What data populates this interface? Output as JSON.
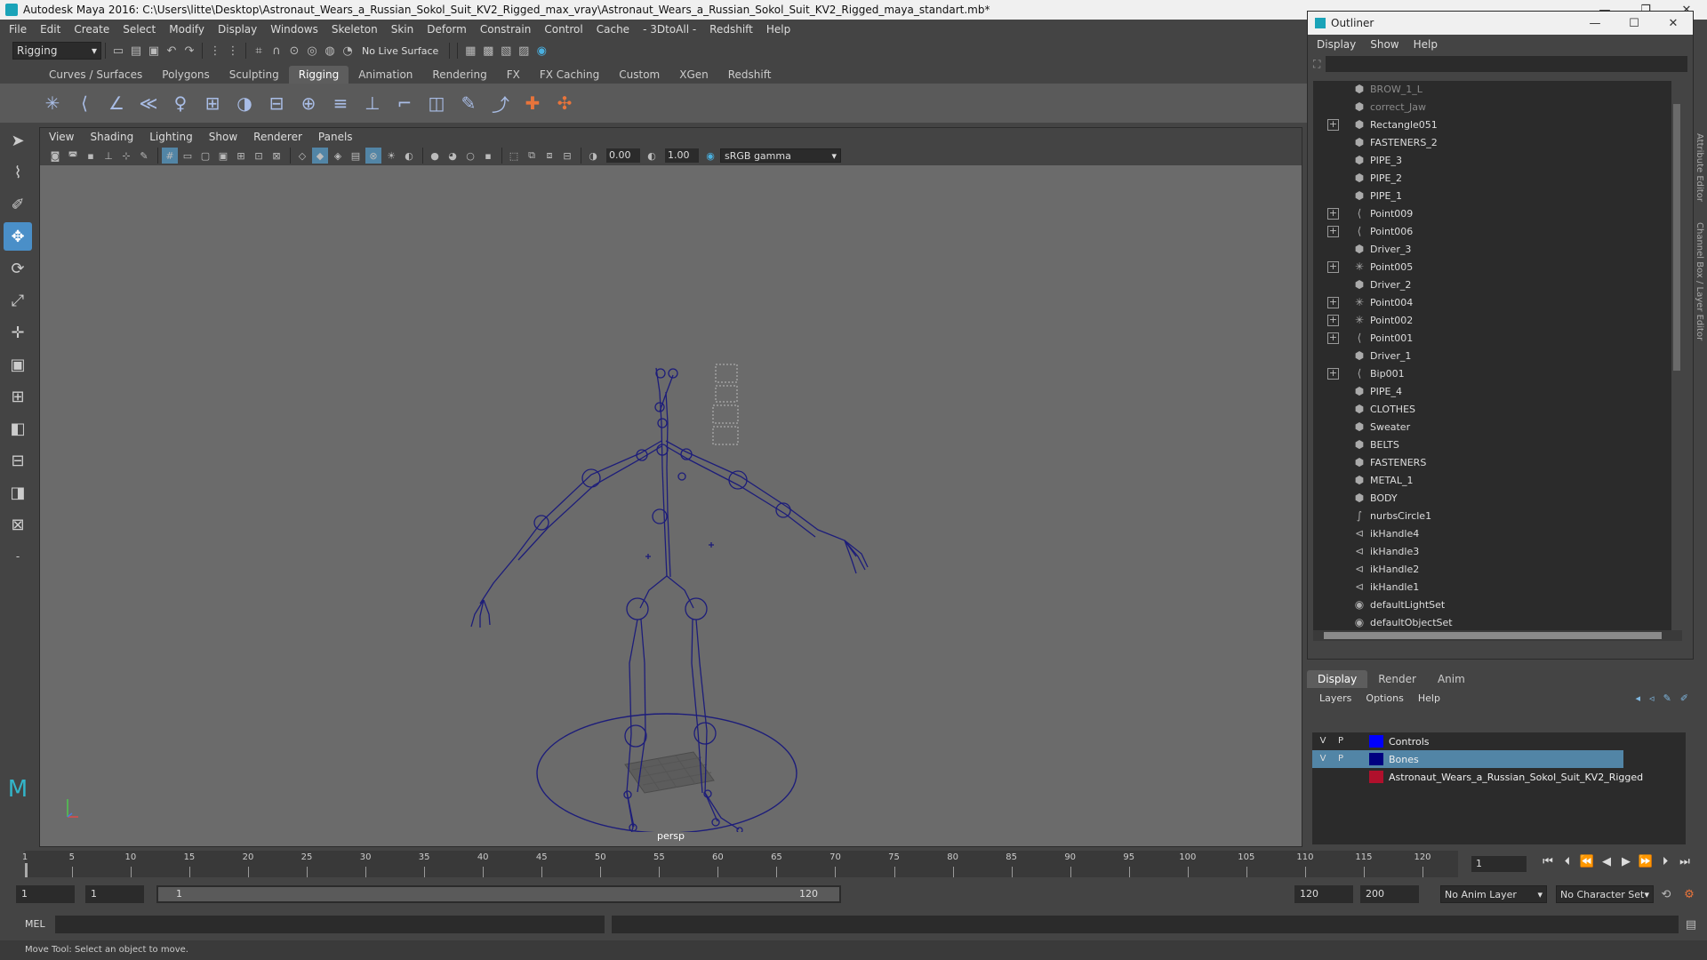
{
  "window": {
    "title": "Autodesk Maya 2016: C:\\Users\\litte\\Desktop\\Astronaut_Wears_a_Russian_Sokol_Suit_KV2_Rigged_max_vray\\Astronaut_Wears_a_Russian_Sokol_Suit_KV2_Rigged_maya_standart.mb*"
  },
  "menubar": [
    "File",
    "Edit",
    "Create",
    "Select",
    "Modify",
    "Display",
    "Windows",
    "Skeleton",
    "Skin",
    "Deform",
    "Constrain",
    "Control",
    "Cache",
    "- 3DtoAll -",
    "Redshift",
    "Help"
  ],
  "statusline": {
    "mode": "Rigging",
    "live_surface": "No Live Surface"
  },
  "shelf": {
    "tabs": [
      "Curves / Surfaces",
      "Polygons",
      "Sculpting",
      "Rigging",
      "Animation",
      "Rendering",
      "FX",
      "FX Caching",
      "Custom",
      "XGen",
      "Redshift"
    ],
    "active_tab": "Rigging"
  },
  "viewport": {
    "menu": [
      "View",
      "Shading",
      "Lighting",
      "Show",
      "Renderer",
      "Panels"
    ],
    "exposure": "0.00",
    "gamma": "1.00",
    "color_space": "sRGB gamma",
    "camera_label": "persp"
  },
  "outliner": {
    "title": "Outliner",
    "menu": [
      "Display",
      "Show",
      "Help"
    ],
    "items": [
      {
        "label": "BROW_1_L",
        "icon": "mesh-icon",
        "expandable": false,
        "dim": true
      },
      {
        "label": "correct_Jaw",
        "icon": "mesh-icon",
        "expandable": false,
        "dim": true
      },
      {
        "label": "Rectangle051",
        "icon": "mesh-icon",
        "expandable": true,
        "dim": false
      },
      {
        "label": "FASTENERS_2",
        "icon": "mesh-icon",
        "expandable": false,
        "dim": false
      },
      {
        "label": "PIPE_3",
        "icon": "mesh-icon",
        "expandable": false,
        "dim": false
      },
      {
        "label": "PIPE_2",
        "icon": "mesh-icon",
        "expandable": false,
        "dim": false
      },
      {
        "label": "PIPE_1",
        "icon": "mesh-icon",
        "expandable": false,
        "dim": false
      },
      {
        "label": "Point009",
        "icon": "joint-icon",
        "expandable": true,
        "dim": false
      },
      {
        "label": "Point006",
        "icon": "joint-icon",
        "expandable": true,
        "dim": false
      },
      {
        "label": "Driver_3",
        "icon": "mesh-icon",
        "expandable": false,
        "dim": false
      },
      {
        "label": "Point005",
        "icon": "locator-icon",
        "expandable": true,
        "dim": false
      },
      {
        "label": "Driver_2",
        "icon": "mesh-icon",
        "expandable": false,
        "dim": false
      },
      {
        "label": "Point004",
        "icon": "locator-icon",
        "expandable": true,
        "dim": false
      },
      {
        "label": "Point002",
        "icon": "locator-icon",
        "expandable": true,
        "dim": false
      },
      {
        "label": "Point001",
        "icon": "joint-icon",
        "expandable": true,
        "dim": false
      },
      {
        "label": "Driver_1",
        "icon": "mesh-icon",
        "expandable": false,
        "dim": false
      },
      {
        "label": "Bip001",
        "icon": "joint-icon",
        "expandable": true,
        "dim": false
      },
      {
        "label": "PIPE_4",
        "icon": "mesh-icon",
        "expandable": false,
        "dim": false
      },
      {
        "label": "CLOTHES",
        "icon": "mesh-icon",
        "expandable": false,
        "dim": false
      },
      {
        "label": "Sweater",
        "icon": "mesh-icon",
        "expandable": false,
        "dim": false
      },
      {
        "label": "BELTS",
        "icon": "mesh-icon",
        "expandable": false,
        "dim": false
      },
      {
        "label": "FASTENERS",
        "icon": "mesh-icon",
        "expandable": false,
        "dim": false
      },
      {
        "label": "METAL_1",
        "icon": "mesh-icon",
        "expandable": false,
        "dim": false
      },
      {
        "label": "BODY",
        "icon": "mesh-icon",
        "expandable": false,
        "dim": false
      },
      {
        "label": "nurbsCircle1",
        "icon": "curve-icon",
        "expandable": false,
        "dim": false
      },
      {
        "label": "ikHandle4",
        "icon": "ik-handle-icon",
        "expandable": false,
        "dim": false
      },
      {
        "label": "ikHandle3",
        "icon": "ik-handle-icon",
        "expandable": false,
        "dim": false
      },
      {
        "label": "ikHandle2",
        "icon": "ik-handle-icon",
        "expandable": false,
        "dim": false
      },
      {
        "label": "ikHandle1",
        "icon": "ik-handle-icon",
        "expandable": false,
        "dim": false
      },
      {
        "label": "defaultLightSet",
        "icon": "set-icon",
        "expandable": false,
        "dim": false
      },
      {
        "label": "defaultObjectSet",
        "icon": "set-icon",
        "expandable": false,
        "dim": false
      }
    ]
  },
  "layer_editor": {
    "tabs": [
      "Display",
      "Render",
      "Anim"
    ],
    "active_tab": "Display",
    "menu": [
      "Layers",
      "Options",
      "Help"
    ],
    "layers": [
      {
        "v": "V",
        "p": "P",
        "name": "Controls",
        "color": "#0000ff",
        "selected": false
      },
      {
        "v": "V",
        "p": "P",
        "name": "Bones",
        "color": "#000080",
        "selected": true
      },
      {
        "v": "",
        "p": "",
        "name": "Astronaut_Wears_a_Russian_Sokol_Suit_KV2_Rigged",
        "color": "#b0102c",
        "selected": false
      }
    ]
  },
  "timeslider": {
    "ticks": [
      "1",
      "5",
      "10",
      "15",
      "20",
      "25",
      "30",
      "35",
      "40",
      "45",
      "50",
      "55",
      "60",
      "65",
      "70",
      "75",
      "80",
      "85",
      "90",
      "95",
      "100",
      "105",
      "110",
      "115",
      "120"
    ],
    "current_frame": "1"
  },
  "range": {
    "start": "1",
    "start_inner": "1",
    "range_start_label": "1",
    "range_end_label": "120",
    "end_inner": "120",
    "end": "200",
    "anim_layer": "No Anim Layer",
    "character_set": "No Character Set"
  },
  "commandline": {
    "label": "MEL"
  },
  "helpline": {
    "text": "Move Tool: Select an object to move."
  },
  "sidetabs": [
    "Attribute Editor",
    "Channel Box / Layer Editor"
  ],
  "colors": {
    "accent": "#4a8fc8",
    "rig_blue": "#1d1d7a",
    "selected_layer": "#5285a6"
  }
}
